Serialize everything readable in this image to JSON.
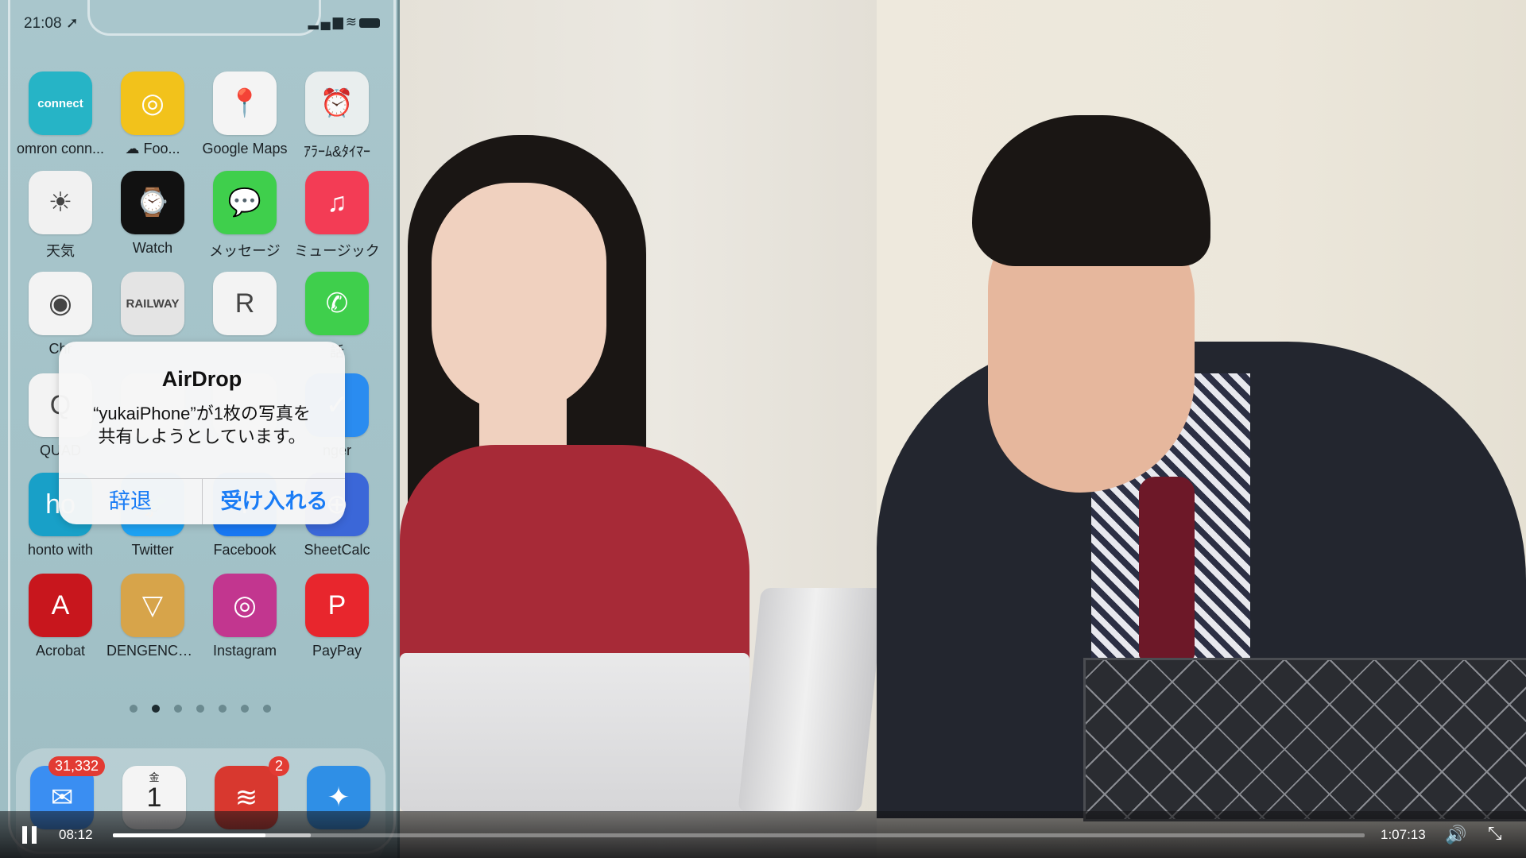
{
  "player": {
    "elapsed": "08:12",
    "duration": "1:07:13",
    "progress_fraction": 0.122,
    "buffered_fraction": 0.158
  },
  "phone": {
    "status_time": "21:08",
    "page_dots_count": 7,
    "page_dot_active": 1,
    "apps": [
      {
        "label": "omron conn...",
        "icon": "omron-connect-icon",
        "glyph": "connect",
        "color": "#26b4c6"
      },
      {
        "label": "Foo...",
        "icon": "food-app-icon",
        "glyph": "◎",
        "color": "#f2c21b",
        "prefix": "☁ "
      },
      {
        "label": "Google Maps",
        "icon": "google-maps-icon",
        "glyph": "📍",
        "color": "#f4f4f4"
      },
      {
        "label": "ｱﾗｰﾑ&ﾀｲﾏｰ",
        "icon": "alarm-clock-icon",
        "glyph": "⏰",
        "color": "#e9eeee"
      },
      {
        "label": "天気",
        "icon": "weather-icon",
        "glyph": "☀",
        "color": "#f1f1f1"
      },
      {
        "label": "Watch",
        "icon": "watch-icon",
        "glyph": "⌚",
        "color": "#111111"
      },
      {
        "label": "メッセージ",
        "icon": "messages-icon",
        "glyph": "💬",
        "color": "#3fcf4c"
      },
      {
        "label": "ミュージック",
        "icon": "music-icon",
        "glyph": "♫",
        "color": "#f33c55"
      },
      {
        "label": "Chr",
        "icon": "chrome-icon",
        "glyph": "◉",
        "color": "#f3f3f3"
      },
      {
        "label": "",
        "icon": "railway-map-icon",
        "glyph": "RAILWAY",
        "color": "#e4e4e4"
      },
      {
        "label": "",
        "icon": "shopping-bag-icon",
        "glyph": "R",
        "color": "#f3f3f3"
      },
      {
        "label": "話",
        "icon": "phone-icon",
        "glyph": "✆",
        "color": "#3fcf4c"
      },
      {
        "label": "QUAD",
        "icon": "quad-app-icon",
        "glyph": "Q",
        "color": "#f3f3f3"
      },
      {
        "label": "",
        "icon": "hidden-app-icon",
        "glyph": "",
        "color": "#cfe0e3"
      },
      {
        "label": "",
        "icon": "hidden-app-icon-2",
        "glyph": "",
        "color": "#cfe0e3"
      },
      {
        "label": "nger",
        "icon": "messenger-icon",
        "glyph": "✓",
        "color": "#2a8cf0"
      },
      {
        "label": "honto with",
        "icon": "honto-icon",
        "glyph": "ho",
        "color": "#18a0c8"
      },
      {
        "label": "Twitter",
        "icon": "twitter-icon",
        "glyph": "🐦",
        "color": "#1da1f2"
      },
      {
        "label": "Facebook",
        "icon": "facebook-icon",
        "glyph": "f",
        "color": "#1877f2"
      },
      {
        "label": "SheetCalc",
        "icon": "sheetcalc-icon",
        "glyph": "⊕",
        "color": "#3b67d8"
      },
      {
        "label": "Acrobat",
        "icon": "acrobat-icon",
        "glyph": "A",
        "color": "#c8161d"
      },
      {
        "label": "DENGENCAFE",
        "icon": "dengencafe-icon",
        "glyph": "▽",
        "color": "#d7a44a"
      },
      {
        "label": "Instagram",
        "icon": "instagram-icon",
        "glyph": "◎",
        "color": "#c2368f"
      },
      {
        "label": "PayPay",
        "icon": "paypay-icon",
        "glyph": "P",
        "color": "#e8262d"
      }
    ],
    "dock": [
      {
        "icon": "mail-icon",
        "glyph": "✉",
        "color": "#3a8ef2",
        "badge": "31,332"
      },
      {
        "icon": "calendar-icon",
        "glyph": "1",
        "sub": "金",
        "color": "#f4f4f4",
        "badge": ""
      },
      {
        "icon": "todoist-icon",
        "glyph": "≋",
        "color": "#d8382f",
        "badge": "2"
      },
      {
        "icon": "safari-icon",
        "glyph": "✦",
        "color": "#2f8fe6",
        "badge": ""
      }
    ]
  },
  "alert": {
    "title": "AirDrop",
    "message_line1": "“yukaiPhone”が1枚の写真を",
    "message_line2": "共有しようとしています。",
    "decline_label": "辞退",
    "accept_label": "受け入れる"
  }
}
